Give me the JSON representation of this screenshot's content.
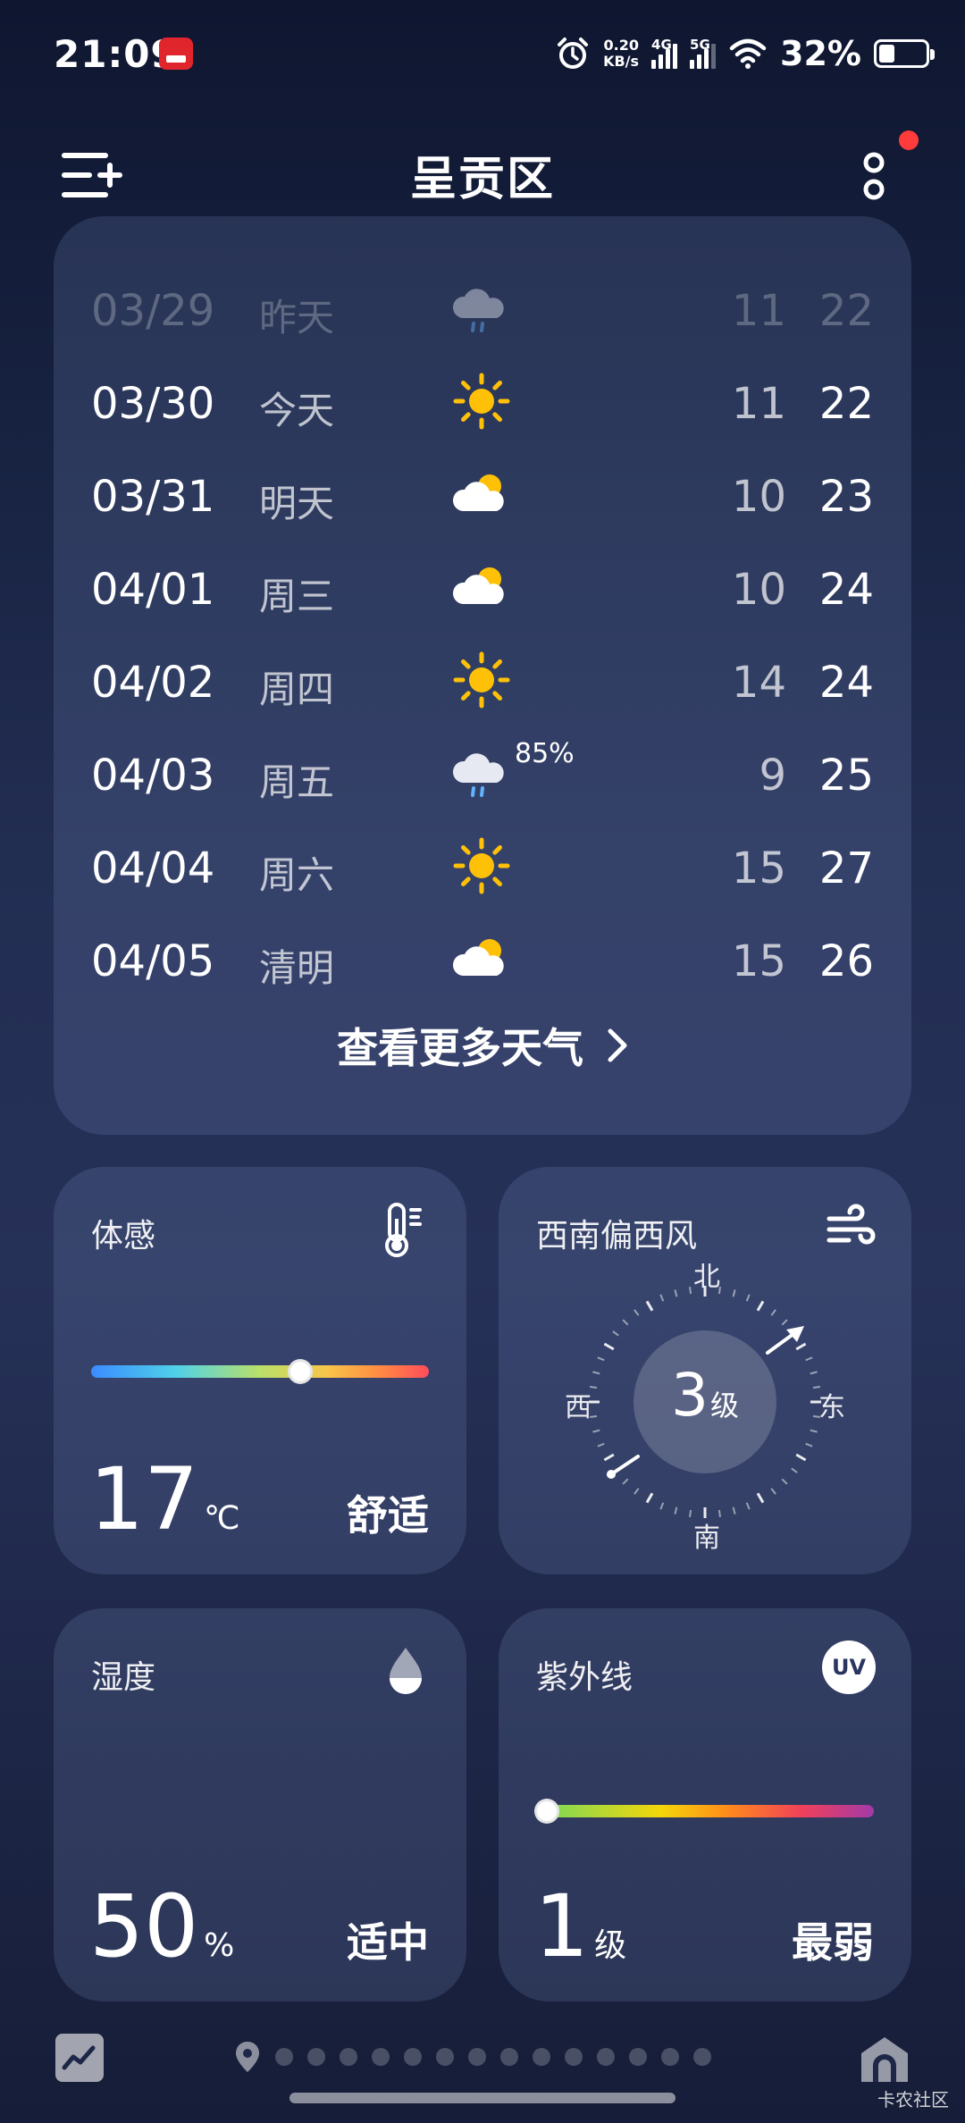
{
  "status_bar": {
    "time": "21:09",
    "net_speed_value": "0.20",
    "net_speed_unit": "KB/s",
    "signal1": "4G",
    "signal2": "5G",
    "battery": "32%"
  },
  "header": {
    "title": "呈贡区"
  },
  "forecast": {
    "rows": [
      {
        "date": "03/29",
        "day": "昨天",
        "icon": "rain-cloud-icon",
        "precip": "",
        "low": "11",
        "high": "22"
      },
      {
        "date": "03/30",
        "day": "今天",
        "icon": "sun-icon",
        "precip": "",
        "low": "11",
        "high": "22"
      },
      {
        "date": "03/31",
        "day": "明天",
        "icon": "partly-cloudy-icon",
        "precip": "",
        "low": "10",
        "high": "23"
      },
      {
        "date": "04/01",
        "day": "周三",
        "icon": "partly-cloudy-icon",
        "precip": "",
        "low": "10",
        "high": "24"
      },
      {
        "date": "04/02",
        "day": "周四",
        "icon": "sun-icon",
        "precip": "",
        "low": "14",
        "high": "24"
      },
      {
        "date": "04/03",
        "day": "周五",
        "icon": "rain-cloud-icon",
        "precip": "85%",
        "low": "9",
        "high": "25"
      },
      {
        "date": "04/04",
        "day": "周六",
        "icon": "sun-icon",
        "precip": "",
        "low": "15",
        "high": "27"
      },
      {
        "date": "04/05",
        "day": "清明",
        "icon": "partly-cloudy-icon",
        "precip": "",
        "low": "15",
        "high": "26"
      }
    ],
    "more_label": "查看更多天气"
  },
  "feels_like": {
    "title": "体感",
    "value": "17",
    "unit": "℃",
    "status": "舒适",
    "level": 0.62
  },
  "wind": {
    "title": "西南偏西风",
    "level": "3",
    "unit": "级",
    "north": "北",
    "south": "南",
    "east": "东",
    "west": "西"
  },
  "humidity": {
    "title": "湿度",
    "value": "50",
    "unit": "%",
    "status": "适中"
  },
  "uv": {
    "title": "紫外线",
    "icon_text": "UV",
    "value": "1",
    "unit": "级",
    "status": "最弱",
    "level": 0.0
  },
  "watermark": "卡农社区"
}
